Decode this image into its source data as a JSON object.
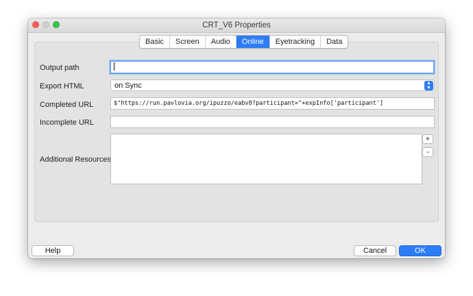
{
  "window": {
    "title": "CRT_V6 Properties"
  },
  "tabs": [
    {
      "label": "Basic"
    },
    {
      "label": "Screen"
    },
    {
      "label": "Audio"
    },
    {
      "label": "Online",
      "active": true
    },
    {
      "label": "Eyetracking"
    },
    {
      "label": "Data"
    }
  ],
  "form": {
    "output_path": {
      "label": "Output path",
      "value": ""
    },
    "export_html": {
      "label": "Export HTML",
      "value": "on Sync"
    },
    "completed_url": {
      "label": "Completed URL",
      "value": "$\"https://run.pavlovia.org/ipuzzo/eabv8?participant=\"+expInfo['participant']"
    },
    "incomplete_url": {
      "label": "Incomplete URL",
      "value": ""
    },
    "additional_resources": {
      "label": "Additional Resources",
      "add_label": "+",
      "remove_label": "-"
    }
  },
  "buttons": {
    "help": "Help",
    "cancel": "Cancel",
    "ok": "OK"
  },
  "colors": {
    "accent": "#2c7cf6",
    "close": "#fc605c",
    "zoom": "#34c84a"
  }
}
